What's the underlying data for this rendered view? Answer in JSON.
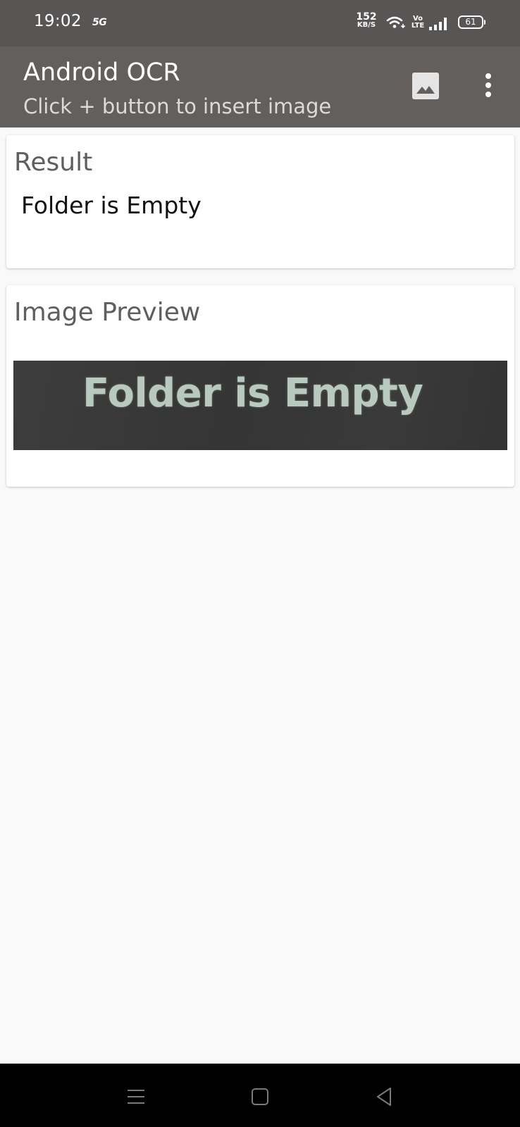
{
  "status_bar": {
    "time": "19:02",
    "network_badge": "5G",
    "net_speed_value": "152",
    "net_speed_unit": "KB/S",
    "volte_top": "Vo",
    "volte_bottom": "LTE",
    "battery_level": "61"
  },
  "app_bar": {
    "title": "Android OCR",
    "subtitle": "Click + button to insert image",
    "actions": [
      "gallery-icon",
      "more-vert-icon"
    ]
  },
  "result_card": {
    "title": "Result",
    "text": "Folder is Empty"
  },
  "preview_card": {
    "title": "Image Preview",
    "image_text": "Folder is Empty"
  },
  "nav_bar": {
    "buttons": [
      "recents-icon",
      "home-icon",
      "back-icon"
    ]
  },
  "colors": {
    "status_bar_bg": "#585555",
    "app_bar_bg": "#625f5c",
    "page_bg": "#f9f9f9",
    "card_bg": "#ffffff",
    "card_title": "#5f5f5f",
    "preview_text": "#b8cac0",
    "nav_bar_bg": "#000000"
  }
}
